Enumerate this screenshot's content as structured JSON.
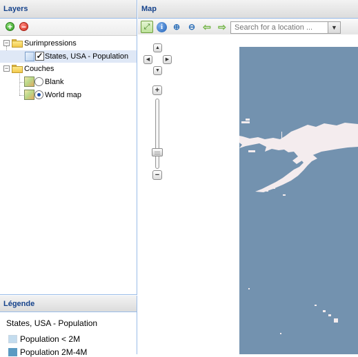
{
  "layers_panel": {
    "title": "Layers",
    "toolbar": {
      "add_icon": "add-icon",
      "remove_icon": "remove-icon"
    },
    "tree": {
      "overlays_folder": {
        "label": "Surimpressions",
        "expander": "−"
      },
      "overlay_layer": {
        "label": "States, USA - Population",
        "checked": true,
        "check_mark": "✓"
      },
      "base_folder": {
        "label": "Couches",
        "expander": "−"
      },
      "base_layers": [
        {
          "label": "Blank",
          "selected": false
        },
        {
          "label": "World map",
          "selected": true
        }
      ]
    }
  },
  "legend_panel": {
    "title": "Légende",
    "layer_title": "States, USA - Population",
    "items": [
      {
        "label": "Population < 2M",
        "color": "#c3dcee"
      },
      {
        "label": "Population 2M-4M",
        "color": "#5b9ac2"
      }
    ]
  },
  "map_panel": {
    "title": "Map",
    "toolbar": {
      "zoom_extent_icon": "zoom-extent-icon",
      "info_icon": "info-icon",
      "info_glyph": "i",
      "zoom_in_icon": "zoom-in-icon",
      "zoom_out_icon": "zoom-out-icon",
      "back_icon": "arrow-left-icon",
      "forward_icon": "arrow-right-icon",
      "search_placeholder": "Search for a location ...",
      "search_trigger_glyph": "▼"
    },
    "nav": {
      "pan_up": "▲",
      "pan_left": "◀",
      "pan_right": "▶",
      "pan_down": "▼",
      "zoom_in": "+",
      "zoom_out": "−"
    },
    "colors": {
      "ocean": "#7392af",
      "land": "#f4ecee"
    }
  }
}
